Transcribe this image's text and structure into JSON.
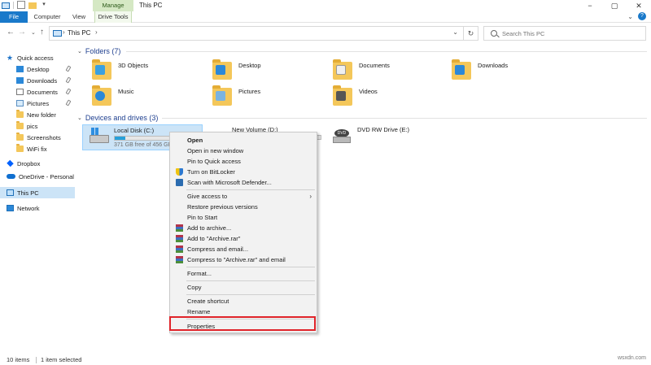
{
  "window": {
    "title": "This PC",
    "manage_tab": "Manage",
    "controls": {
      "minimize": "−",
      "maximize": "▢",
      "close": "✕"
    }
  },
  "ribbon": {
    "tabs": [
      "File",
      "Computer",
      "View",
      "Drive Tools"
    ],
    "expand_icon": "⌄",
    "help_icon": "?"
  },
  "address": {
    "back": "←",
    "forward": "→",
    "recent": "⌄",
    "up": "↑",
    "path": "This PC",
    "chevron": "›",
    "dropdown": "⌄",
    "refresh": "↻"
  },
  "search": {
    "placeholder": "Search This PC"
  },
  "sidebar": {
    "items": [
      {
        "label": "Quick access",
        "icon": "star-icon"
      },
      {
        "label": "Desktop",
        "icon": "desktop-icon",
        "pinned": true
      },
      {
        "label": "Downloads",
        "icon": "downloads-icon",
        "pinned": true
      },
      {
        "label": "Documents",
        "icon": "documents-icon",
        "pinned": true
      },
      {
        "label": "Pictures",
        "icon": "pictures-icon",
        "pinned": true
      },
      {
        "label": "New folder",
        "icon": "folder-icon"
      },
      {
        "label": "pics",
        "icon": "folder-icon"
      },
      {
        "label": "Screenshots",
        "icon": "folder-icon"
      },
      {
        "label": "WiFi fix",
        "icon": "folder-icon"
      },
      {
        "label": "Dropbox",
        "icon": "dropbox-icon"
      },
      {
        "label": "OneDrive - Personal",
        "icon": "onedrive-icon"
      },
      {
        "label": "This PC",
        "icon": "this-pc-icon",
        "selected": true
      },
      {
        "label": "Network",
        "icon": "network-icon"
      }
    ]
  },
  "folders": {
    "header": "Folders (7)",
    "items": [
      {
        "name": "3D Objects",
        "badge_color": "#3aa0e0"
      },
      {
        "name": "Desktop",
        "badge_color": "#2b88d8"
      },
      {
        "name": "Documents",
        "badge_color": "#e8e8e8"
      },
      {
        "name": "Downloads",
        "badge_color": "#2b88d8"
      },
      {
        "name": "Music",
        "badge_color": "#2b88d8"
      },
      {
        "name": "Pictures",
        "badge_color": "#7ab3e0"
      },
      {
        "name": "Videos",
        "badge_color": "#555555"
      }
    ]
  },
  "devices": {
    "header": "Devices and drives (3)",
    "drives": [
      {
        "name": "Local Disk (C:)",
        "free": "371 GB free of 456 GB",
        "used_fraction": 0.19,
        "selected": true
      },
      {
        "name": "New Volume (D:)"
      },
      {
        "name": "DVD RW Drive (E:)",
        "disc_label": "DVD"
      }
    ]
  },
  "context_menu": {
    "items": [
      {
        "label": "Open",
        "bold": true
      },
      {
        "label": "Open in new window"
      },
      {
        "label": "Pin to Quick access"
      },
      {
        "label": "Turn on BitLocker",
        "icon": "shield-icon"
      },
      {
        "label": "Scan with Microsoft Defender...",
        "icon": "defender-icon"
      },
      {
        "label": "Give access to",
        "submenu": true
      },
      {
        "label": "Restore previous versions"
      },
      {
        "label": "Pin to Start"
      },
      {
        "label": "Add to archive...",
        "icon": "winrar-icon"
      },
      {
        "label": "Add to \"Archive.rar\"",
        "icon": "winrar-icon"
      },
      {
        "label": "Compress and email...",
        "icon": "winrar-icon"
      },
      {
        "label": "Compress to \"Archive.rar\" and email",
        "icon": "winrar-icon"
      },
      {
        "label": "Format..."
      },
      {
        "label": "Copy"
      },
      {
        "label": "Create shortcut"
      },
      {
        "label": "Rename"
      },
      {
        "label": "Properties",
        "highlighted": true
      }
    ],
    "submenu_arrow": "›",
    "highlight_color": "#e0242a"
  },
  "status": {
    "count": "10 items",
    "selection": "1 item selected",
    "watermark": "wsxdn.com"
  },
  "colors": {
    "accent": "#1979ca",
    "selection": "#cce4f7",
    "header_text": "#1e3f8f"
  }
}
